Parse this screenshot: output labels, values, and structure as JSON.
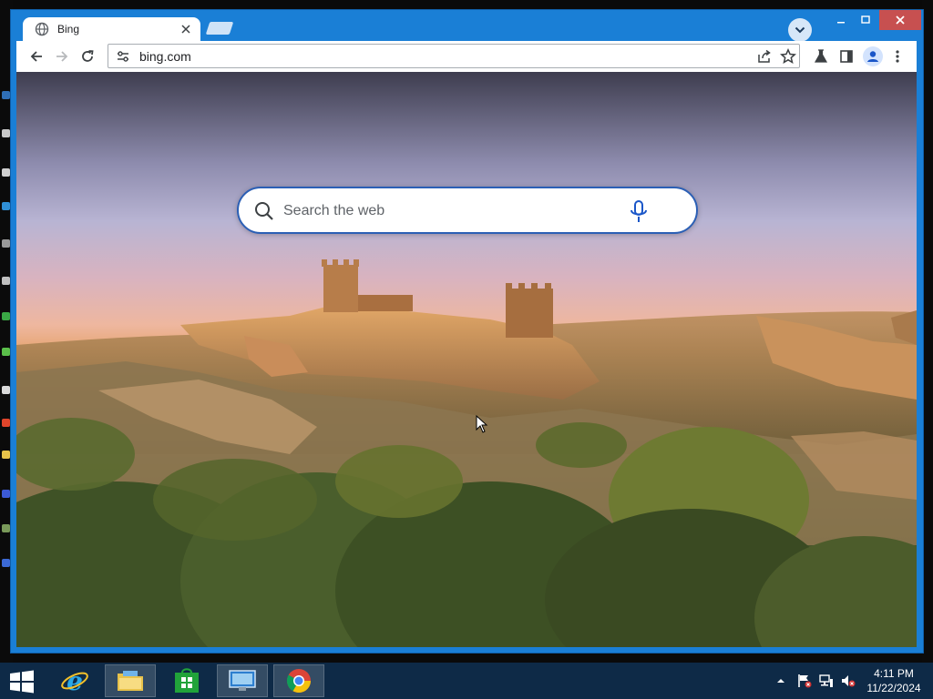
{
  "browser": {
    "tab": {
      "title": "Bing"
    },
    "omnibox": {
      "url": "bing.com"
    }
  },
  "bing": {
    "search": {
      "placeholder": "Search the web"
    }
  },
  "taskbar": {
    "items": [
      "internet-explorer",
      "file-explorer",
      "store",
      "remote-desktop",
      "chrome"
    ],
    "clock": {
      "time": "4:11 PM",
      "date": "11/22/2024"
    }
  },
  "colors": {
    "window_accent": "#1a7fd6",
    "close_button": "#c75050",
    "taskbar": "#0e2a47",
    "search_border": "#2b5fb5"
  }
}
